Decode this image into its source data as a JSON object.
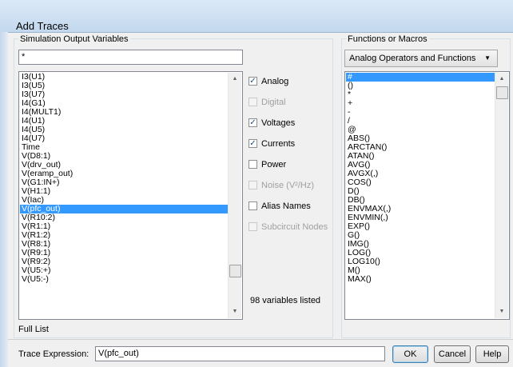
{
  "window": {
    "title": "Add Traces"
  },
  "sim_output": {
    "group_label": "Simulation Output Variables",
    "filter_value": "*",
    "variables": [
      "I3(U1)",
      "I3(U5)",
      "I3(U7)",
      "I4(G1)",
      "I4(MULT1)",
      "I4(U1)",
      "I4(U5)",
      "I4(U7)",
      "Time",
      "V(D8:1)",
      "V(drv_out)",
      "V(eramp_out)",
      "V(G1:IN+)",
      "V(H1:1)",
      "V(Iac)",
      "V(pfc_out)",
      "V(R10:2)",
      "V(R1:1)",
      "V(R1:2)",
      "V(R8:1)",
      "V(R9:1)",
      "V(R9:2)",
      "V(U5:+)",
      "V(U5:-)"
    ],
    "selected": "V(pfc_out)",
    "full_list_label": "Full List",
    "scroll_position": 0.83
  },
  "filters": {
    "analog": {
      "label": "Analog",
      "checked": true,
      "enabled": true
    },
    "digital": {
      "label": "Digital",
      "checked": false,
      "enabled": false
    },
    "voltages": {
      "label": "Voltages",
      "checked": true,
      "enabled": true
    },
    "currents": {
      "label": "Currents",
      "checked": true,
      "enabled": true
    },
    "power": {
      "label": "Power",
      "checked": false,
      "enabled": true
    },
    "noise": {
      "label": "Noise (V²/Hz)",
      "checked": false,
      "enabled": false
    },
    "alias_names": {
      "label": "Alias Names",
      "checked": false,
      "enabled": true
    },
    "subcircuit_nodes": {
      "label": "Subcircuit Nodes",
      "checked": false,
      "enabled": false
    },
    "count_text": "98 variables listed"
  },
  "functions": {
    "group_label": "Functions or Macros",
    "dropdown_value": "Analog Operators and Functions",
    "items": [
      "#",
      "()",
      "*",
      "+",
      "-",
      "/",
      "@",
      "ABS()",
      "ARCTAN()",
      "ATAN()",
      "AVG()",
      "AVGX(,)",
      "COS()",
      "D()",
      "DB()",
      "ENVMAX(,)",
      "ENVMIN(,)",
      "EXP()",
      "G()",
      "IMG()",
      "LOG()",
      "LOG10()",
      "M()",
      "MAX()"
    ],
    "selected": "#",
    "scroll_position": 0.0
  },
  "trace": {
    "label": "Trace Expression:",
    "value": "V(pfc_out)",
    "ok_label": "OK",
    "cancel_label": "Cancel",
    "help_label": "Help"
  },
  "icons": {
    "check": "check-icon",
    "scroll_up": "scroll-up-icon",
    "scroll_down": "scroll-down-icon",
    "dropdown": "chevron-down-icon"
  },
  "colors": {
    "selection": "#3399ff"
  }
}
